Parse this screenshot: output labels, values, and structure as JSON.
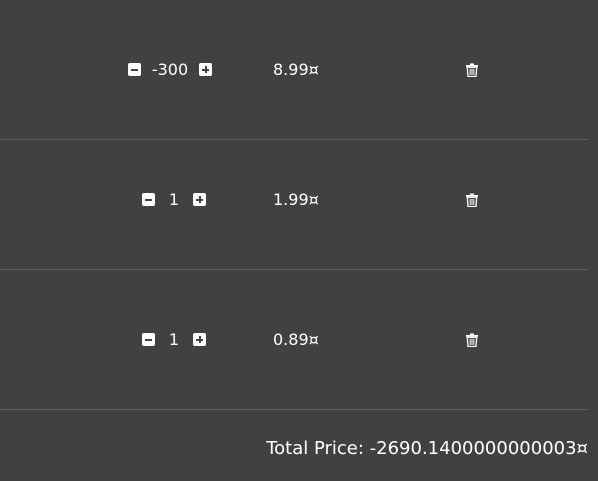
{
  "cart": {
    "items": [
      {
        "quantity": "-300",
        "price": "8.99¤",
        "decrease_icon": "minus-square-icon",
        "increase_icon": "plus-square-icon",
        "delete_icon": "trash-icon"
      },
      {
        "quantity": "1",
        "price": "1.99¤",
        "decrease_icon": "minus-square-icon",
        "increase_icon": "plus-square-icon",
        "delete_icon": "trash-icon"
      },
      {
        "quantity": "1",
        "price": "0.89¤",
        "decrease_icon": "minus-square-icon",
        "increase_icon": "plus-square-icon",
        "delete_icon": "trash-icon"
      }
    ],
    "total_label": "Total Price: -2690.1400000000003¤"
  },
  "colors": {
    "background": "#414141",
    "divider": "#5e5e5e",
    "text": "#ffffff"
  }
}
